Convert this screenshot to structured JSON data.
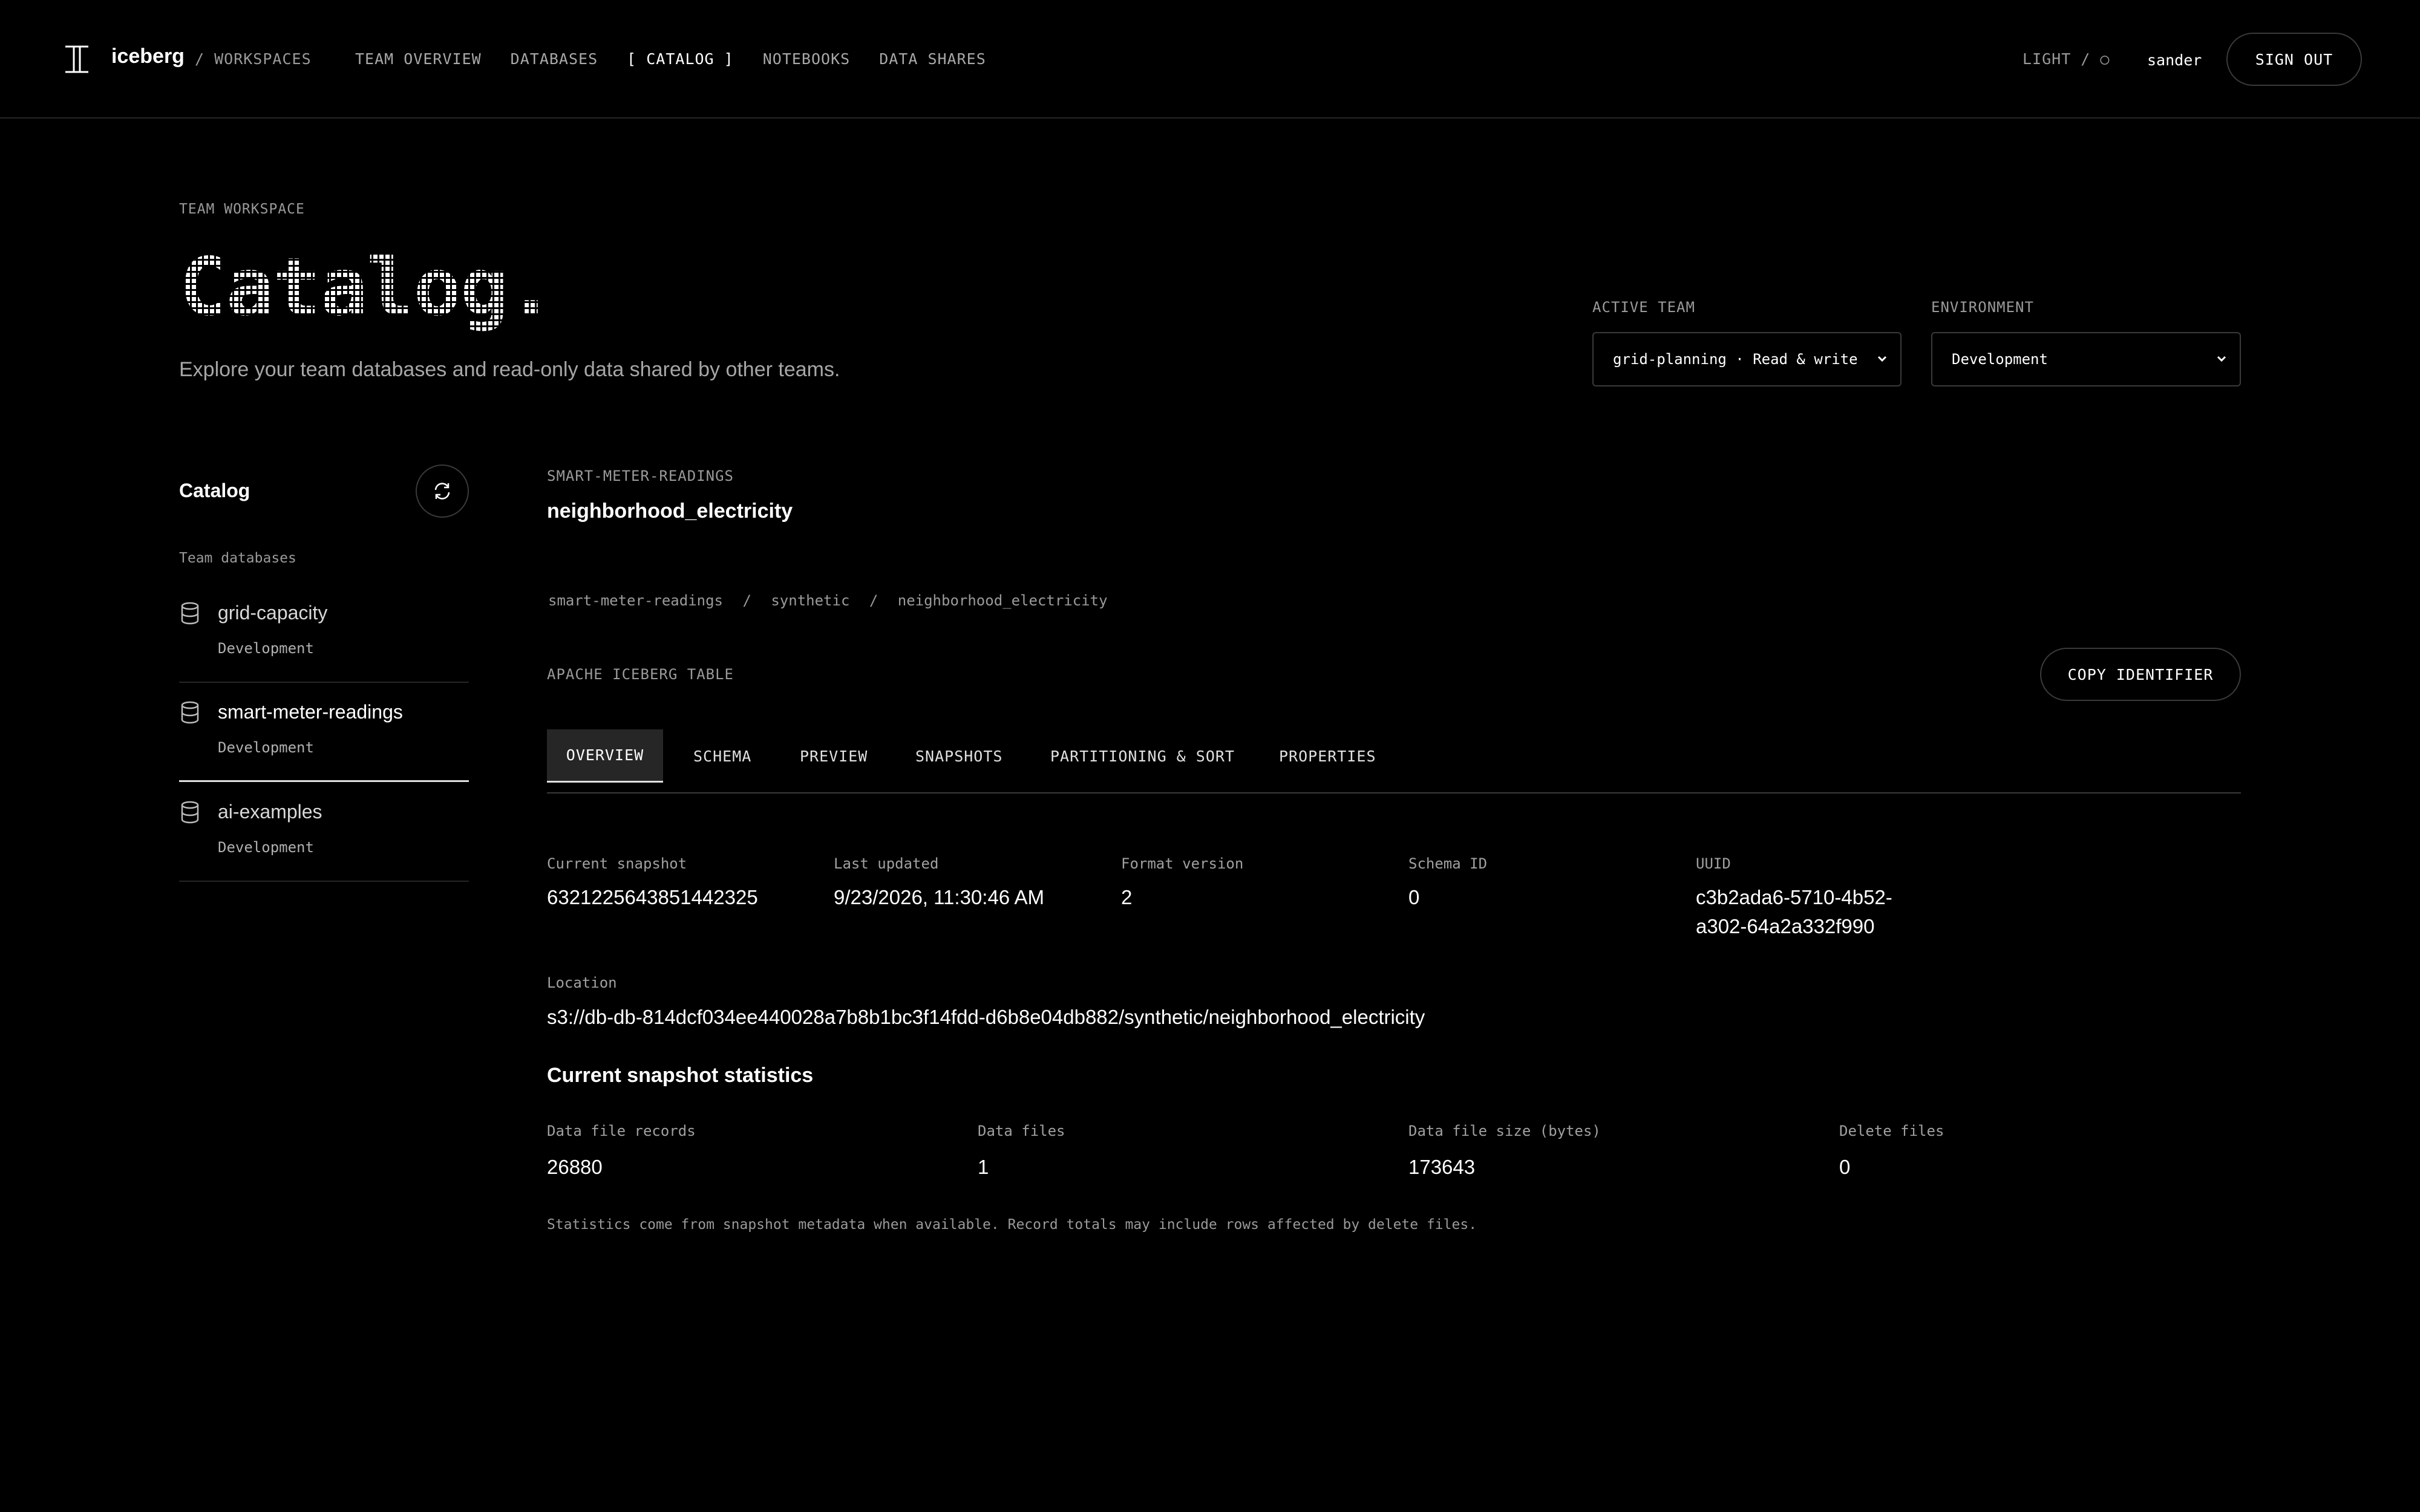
{
  "nav": {
    "brand": "iceberg",
    "workspace_crumb": "/ WORKSPACES",
    "links": [
      {
        "label": "TEAM OVERVIEW"
      },
      {
        "label": "DATABASES"
      },
      {
        "label": "[ CATALOG ]"
      },
      {
        "label": "NOTEBOOKS"
      },
      {
        "label": "DATA SHARES"
      }
    ],
    "theme_toggle": "LIGHT / ○",
    "user": "sander",
    "sign_out": "SIGN OUT"
  },
  "header": {
    "eyebrow": "TEAM WORKSPACE",
    "title": "Catalog.",
    "subtitle": "Explore your team databases and read-only data shared by other teams.",
    "active_team_label": "ACTIVE TEAM",
    "active_team_value": "grid-planning · Read & write",
    "environment_label": "ENVIRONMENT",
    "environment_value": "Development"
  },
  "sidebar": {
    "title": "Catalog",
    "section": "Team databases",
    "items": [
      {
        "name": "grid-capacity",
        "env": "Development"
      },
      {
        "name": "smart-meter-readings",
        "env": "Development"
      },
      {
        "name": "ai-examples",
        "env": "Development"
      }
    ]
  },
  "main": {
    "eyebrow": "SMART-METER-READINGS",
    "title": "neighborhood_electricity",
    "breadcrumb": [
      "smart-meter-readings",
      "/",
      "synthetic",
      "/",
      "neighborhood_electricity"
    ],
    "kind": "APACHE ICEBERG TABLE",
    "copy_button": "COPY IDENTIFIER",
    "tabs": [
      "OVERVIEW",
      "SCHEMA",
      "PREVIEW",
      "SNAPSHOTS",
      "PARTITIONING & SORT",
      "PROPERTIES"
    ],
    "overview": {
      "current_snapshot_label": "Current snapshot",
      "current_snapshot": "6321225643851442325",
      "last_updated_label": "Last updated",
      "last_updated": "9/23/2026, 11:30:46 AM",
      "format_version_label": "Format version",
      "format_version": "2",
      "schema_id_label": "Schema ID",
      "schema_id": "0",
      "uuid_label": "UUID",
      "uuid_line1": "c3b2ada6-5710-4b52-",
      "uuid_line2": "a302-64a2a332f990",
      "location_label": "Location",
      "location": "s3://db-db-814dcf034ee440028a7b8b1bc3f14fdd-d6b8e04db882/synthetic/neighborhood_electricity"
    },
    "stats": {
      "heading": "Current snapshot statistics",
      "records_label": "Data file records",
      "records": "26880",
      "files_label": "Data files",
      "files": "1",
      "size_label": "Data file size (bytes)",
      "size": "173643",
      "deletes_label": "Delete files",
      "deletes": "0",
      "note": "Statistics come from snapshot metadata when available. Record totals may include rows affected by delete files."
    }
  }
}
